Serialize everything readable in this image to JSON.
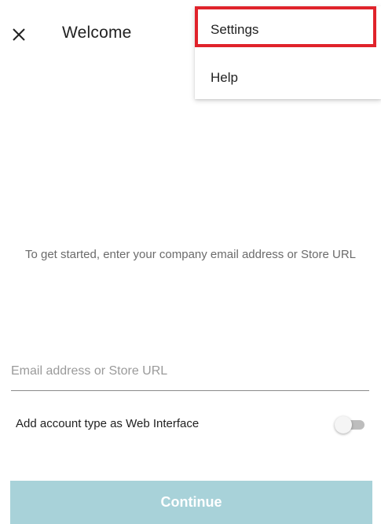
{
  "app_bar": {
    "title": "Welcome",
    "close_icon": "close-icon"
  },
  "menu": {
    "items": [
      {
        "label": "Settings",
        "highlighted": true
      },
      {
        "label": "Help",
        "highlighted": false
      }
    ],
    "highlight_color": "#e0232b"
  },
  "main": {
    "prompt": "To get started, enter your company email address or Store URL",
    "email_field": {
      "placeholder": "Email address or Store URL",
      "value": ""
    },
    "account_type_toggle": {
      "label": "Add account type as Web Interface",
      "on": false
    },
    "continue_button": {
      "label": "Continue",
      "enabled": false,
      "color": "#a8d2d9"
    }
  }
}
